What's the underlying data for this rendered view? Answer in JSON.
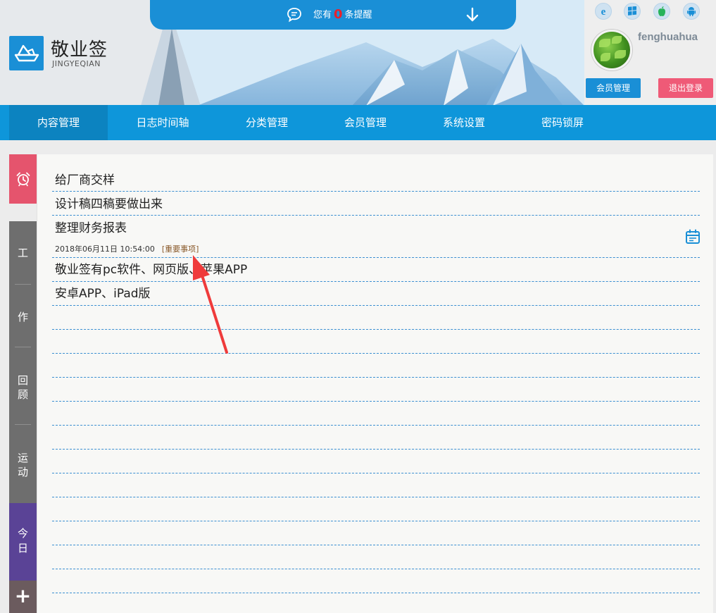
{
  "reminder": {
    "prefix": "您有",
    "count": "0",
    "suffix": "条提醒"
  },
  "brand": {
    "name": "敬业签",
    "sub": "JINGYEQIAN"
  },
  "platform_icons": [
    "ie-icon",
    "windows-icon",
    "apple-icon",
    "android-icon"
  ],
  "user": {
    "name": "fenghuahua",
    "member_btn": "会员管理",
    "logout_btn": "退出登录"
  },
  "nav": [
    "内容管理",
    "日志时间轴",
    "分类管理",
    "会员管理",
    "系统设置",
    "密码锁屏"
  ],
  "side_tabs": {
    "work": [
      "工",
      "作",
      "回顾",
      "运动"
    ],
    "today": "今日",
    "add": "+"
  },
  "notes": [
    "给厂商交样",
    "设计稿四稿要做出来",
    "整理财务报表",
    "敬业签有pc软件、网页版、苹果APP",
    "安卓APP、iPad版"
  ],
  "note_meta": {
    "datetime": "2018年06月11日 10:54:00",
    "tag": "[重要事项]"
  },
  "colors": {
    "accent": "#1a8fd6",
    "nav": "#0e96da",
    "alarm": "#e5546d",
    "today": "#5a4396",
    "logout": "#ef5a77"
  }
}
